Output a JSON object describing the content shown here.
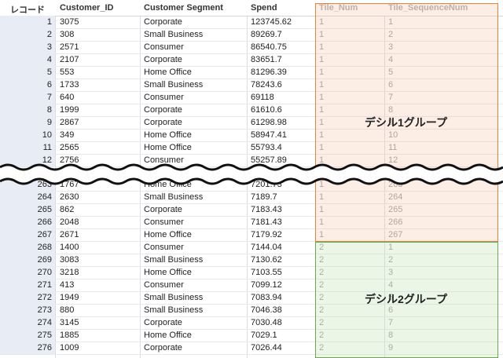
{
  "headers": [
    "レコード",
    "Customer_ID",
    "Customer Segment",
    "Spend",
    "Tile_Num",
    "Tile_SequenceNum"
  ],
  "rows_top": [
    [
      "1",
      "3075",
      "Corporate",
      "123745.62",
      "1",
      "1"
    ],
    [
      "2",
      "308",
      "Small Business",
      "89269.7",
      "1",
      "2"
    ],
    [
      "3",
      "2571",
      "Consumer",
      "86540.75",
      "1",
      "3"
    ],
    [
      "4",
      "2107",
      "Corporate",
      "83651.7",
      "1",
      "4"
    ],
    [
      "5",
      "553",
      "Home Office",
      "81296.39",
      "1",
      "5"
    ],
    [
      "6",
      "1733",
      "Small Business",
      "78243.6",
      "1",
      "6"
    ],
    [
      "7",
      "640",
      "Consumer",
      "69118",
      "1",
      "7"
    ],
    [
      "8",
      "1999",
      "Corporate",
      "61610.6",
      "1",
      "8"
    ],
    [
      "9",
      "2867",
      "Corporate",
      "61298.98",
      "1",
      "9"
    ],
    [
      "10",
      "349",
      "Home Office",
      "58947.41",
      "1",
      "10"
    ],
    [
      "11",
      "2565",
      "Home Office",
      "55793.4",
      "1",
      "11"
    ],
    [
      "12",
      "2756",
      "Consumer",
      "55257.89",
      "1",
      "12"
    ]
  ],
  "rows_bottom": [
    [
      "263",
      "1767",
      "Home Office",
      "7201.73",
      "1",
      "263"
    ],
    [
      "264",
      "2630",
      "Small Business",
      "7189.7",
      "1",
      "264"
    ],
    [
      "265",
      "862",
      "Corporate",
      "7183.43",
      "1",
      "265"
    ],
    [
      "266",
      "2048",
      "Consumer",
      "7181.43",
      "1",
      "266"
    ],
    [
      "267",
      "2671",
      "Home Office",
      "7179.92",
      "1",
      "267"
    ],
    [
      "268",
      "1400",
      "Consumer",
      "7144.04",
      "2",
      "1"
    ],
    [
      "269",
      "3083",
      "Small Business",
      "7130.62",
      "2",
      "2"
    ],
    [
      "270",
      "3218",
      "Home Office",
      "7103.55",
      "2",
      "3"
    ],
    [
      "271",
      "413",
      "Consumer",
      "7099.12",
      "2",
      "4"
    ],
    [
      "272",
      "1949",
      "Small Business",
      "7083.94",
      "2",
      "5"
    ],
    [
      "273",
      "880",
      "Small Business",
      "7046.38",
      "2",
      "6"
    ],
    [
      "274",
      "3145",
      "Corporate",
      "7030.48",
      "2",
      "7"
    ],
    [
      "275",
      "1885",
      "Home Office",
      "7029.1",
      "2",
      "8"
    ],
    [
      "276",
      "1009",
      "Corporate",
      "7026.44",
      "2",
      "9"
    ]
  ],
  "group_labels": {
    "group1": "デシル1グループ",
    "group2": "デシル2グループ"
  },
  "colors": {
    "group1_border": "#e8843a",
    "group2_border": "#6aa84f"
  }
}
